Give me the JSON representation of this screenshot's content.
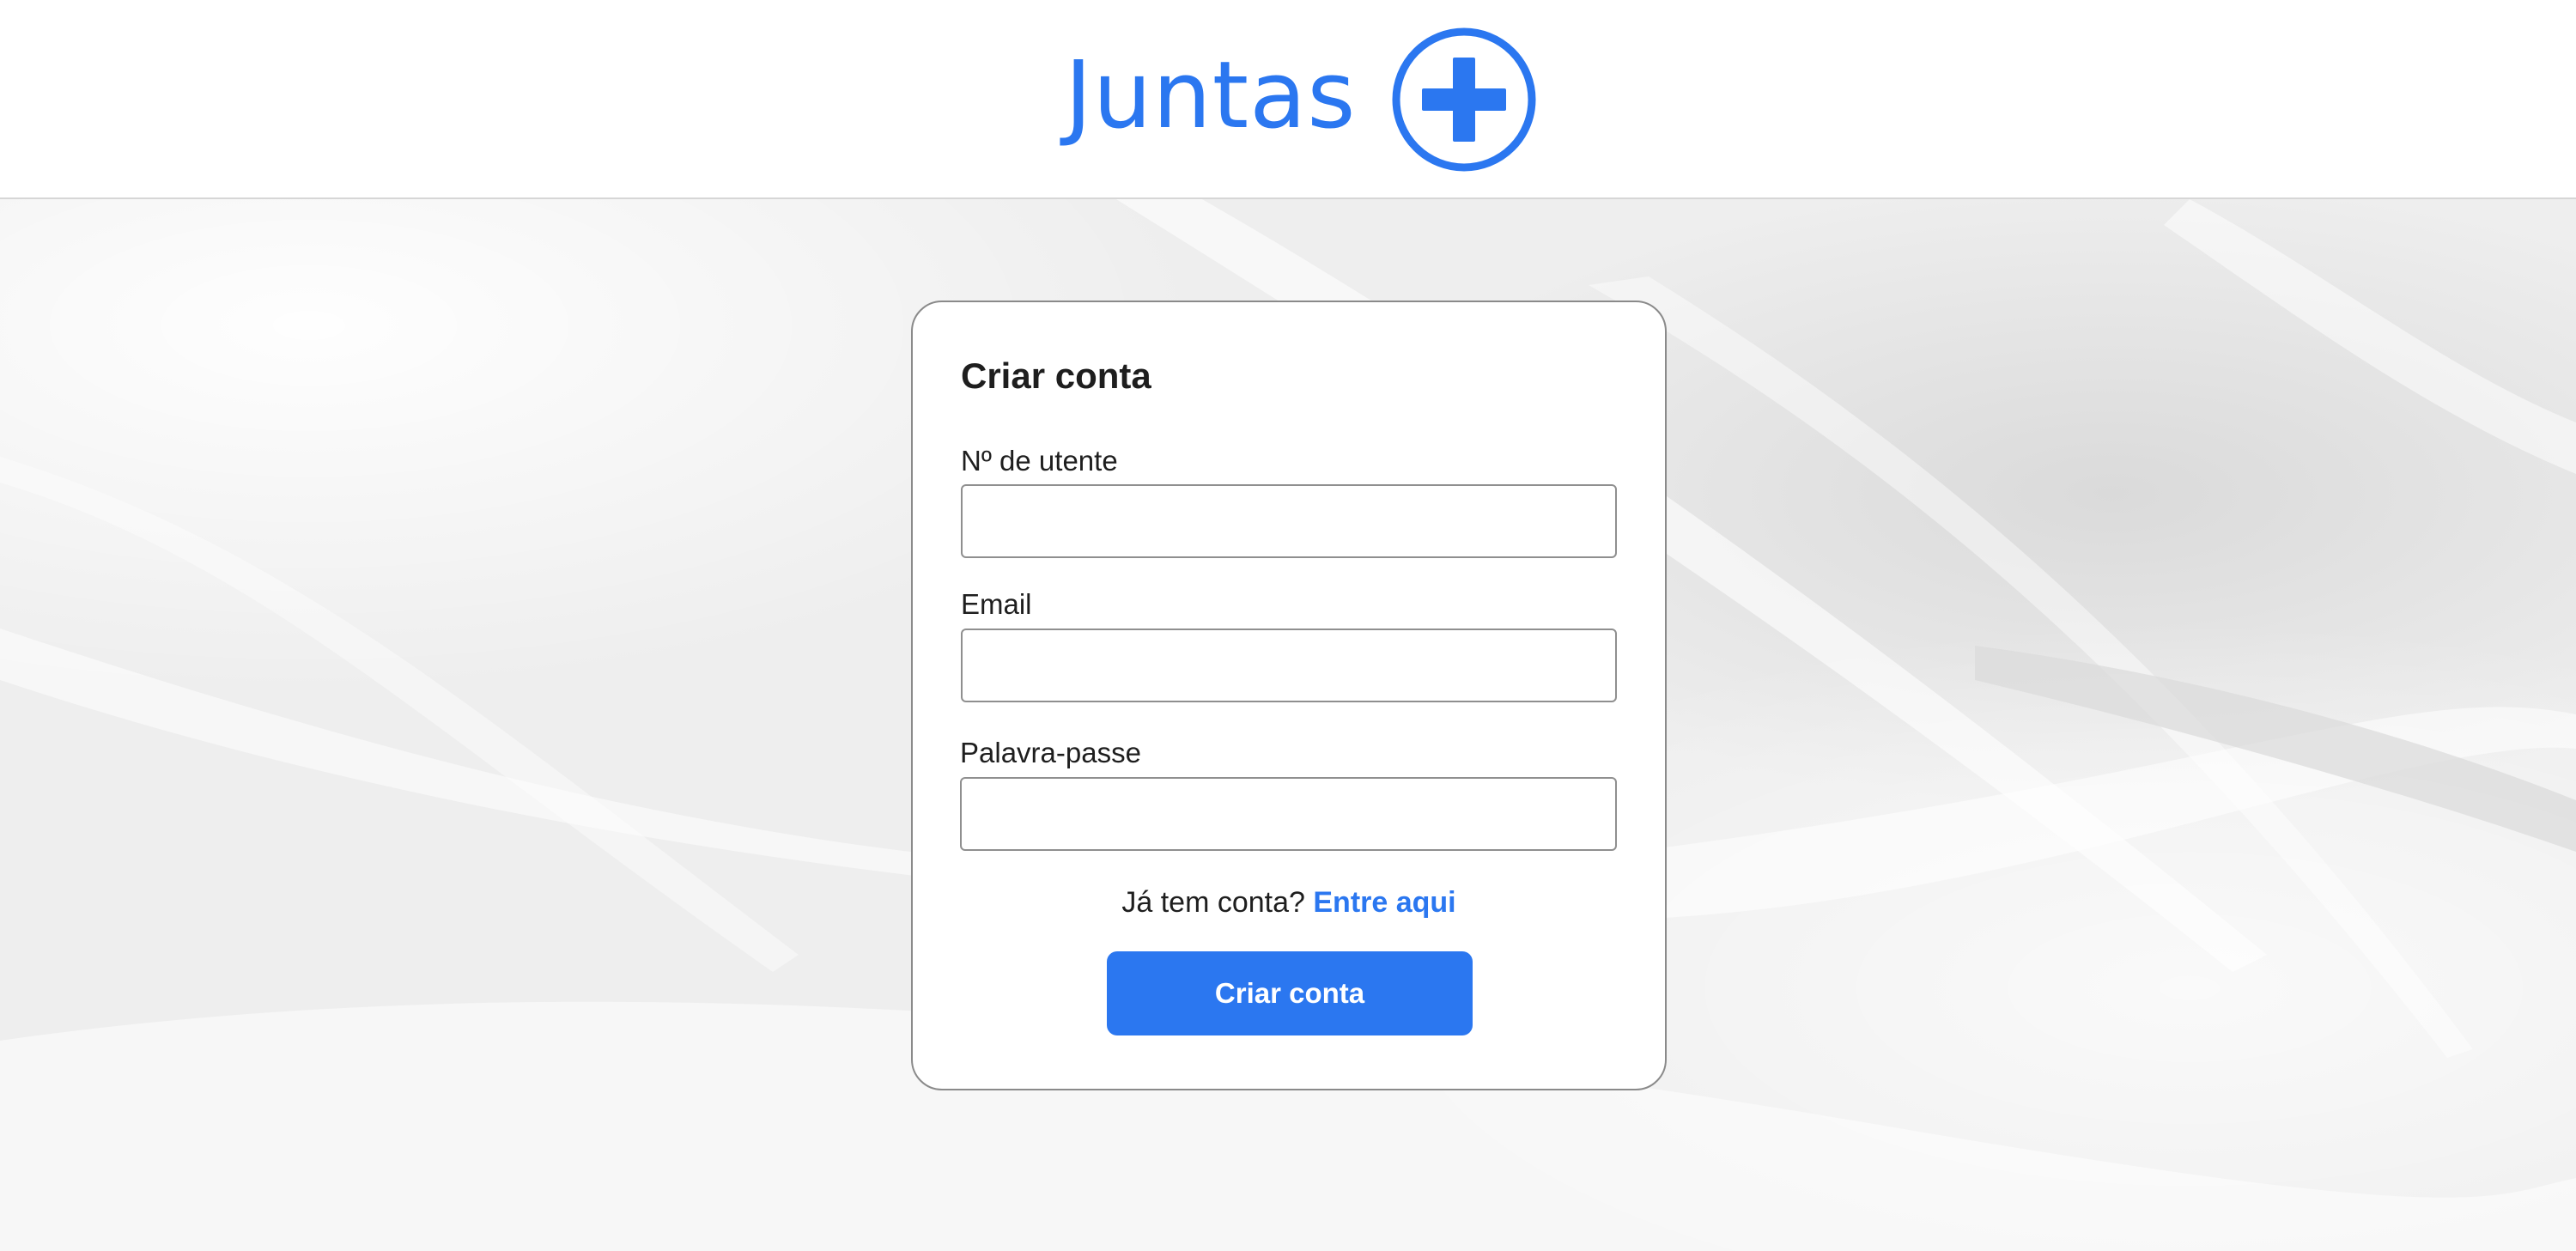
{
  "header": {
    "brand_name": "Juntas",
    "brand_icon": "plus-circle-icon",
    "brand_color": "#2b77f0"
  },
  "form": {
    "title": "Criar conta",
    "fields": [
      {
        "label": "Nº de utente",
        "value": "",
        "placeholder": ""
      },
      {
        "label": "Email",
        "value": "",
        "placeholder": ""
      },
      {
        "label": "Palavra-passe",
        "value": "",
        "placeholder": ""
      }
    ],
    "login_prompt": "Já tem conta?",
    "login_link": "Entre aqui",
    "submit_label": "Criar conta"
  }
}
